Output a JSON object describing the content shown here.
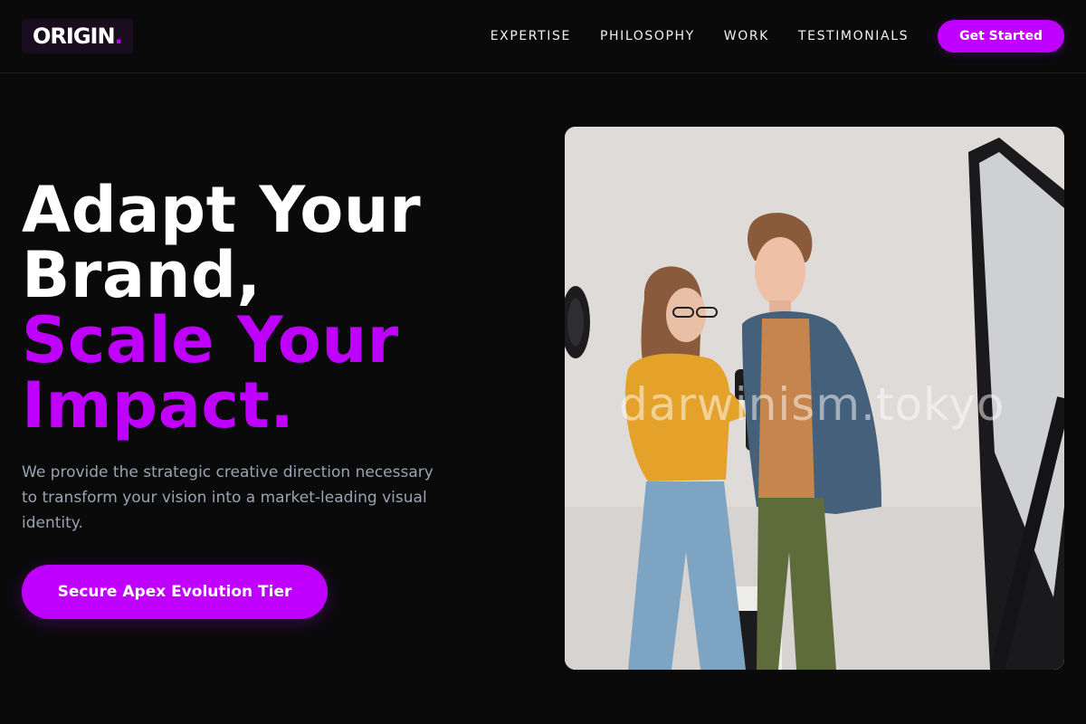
{
  "header": {
    "logo_text": "ORIGIN",
    "logo_dot": ".",
    "nav": [
      {
        "label": "EXPERTISE"
      },
      {
        "label": "PHILOSOPHY"
      },
      {
        "label": "WORK"
      },
      {
        "label": "TESTIMONIALS"
      }
    ],
    "cta_label": "Get Started"
  },
  "hero": {
    "title_lines_white": [
      "Adapt Your",
      "Brand,"
    ],
    "title_lines_purple": [
      "Scale Your",
      "Impact."
    ],
    "description": "We provide the strategic creative direction necessary to transform your vision into a market-leading visual identity.",
    "cta_label": "Secure Apex Evolution Tier"
  },
  "image": {
    "watermark": "darwinism.tokyo"
  },
  "colors": {
    "accent": "#c000ff",
    "background": "#0a0a0b",
    "text_primary": "#ffffff",
    "text_muted": "#9aa3b2"
  }
}
